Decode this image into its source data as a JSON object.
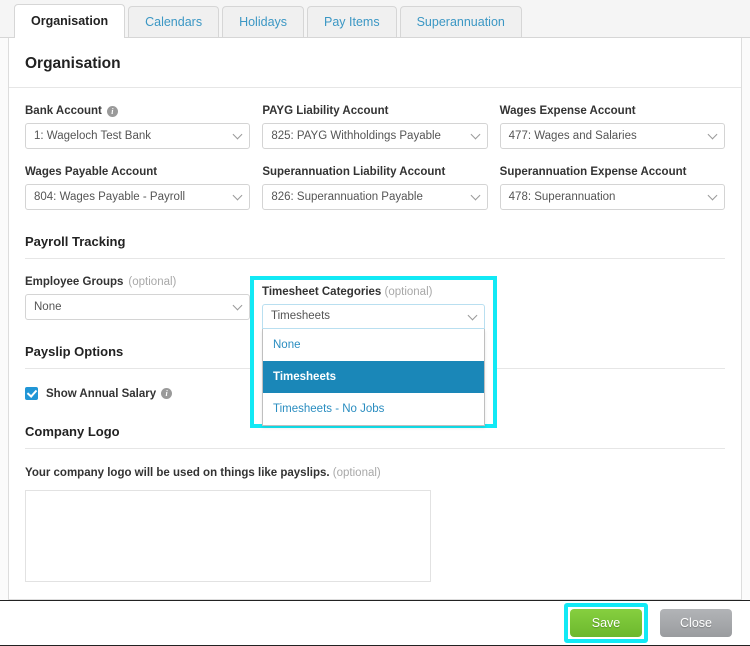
{
  "tabs": [
    {
      "label": "Organisation",
      "active": true
    },
    {
      "label": "Calendars",
      "active": false
    },
    {
      "label": "Holidays",
      "active": false
    },
    {
      "label": "Pay Items",
      "active": false
    },
    {
      "label": "Superannuation",
      "active": false
    }
  ],
  "card": {
    "title": "Organisation"
  },
  "accounts": {
    "row1": [
      {
        "label": "Bank Account",
        "info": true,
        "value": "1: Wageloch Test Bank"
      },
      {
        "label": "PAYG Liability Account",
        "info": false,
        "value": "825: PAYG Withholdings Payable"
      },
      {
        "label": "Wages Expense Account",
        "info": false,
        "value": "477: Wages and Salaries"
      }
    ],
    "row2": [
      {
        "label": "Wages Payable Account",
        "info": false,
        "value": "804: Wages Payable - Payroll"
      },
      {
        "label": "Superannuation Liability Account",
        "info": false,
        "value": "826: Superannuation Payable"
      },
      {
        "label": "Superannuation Expense Account",
        "info": false,
        "value": "478: Superannuation"
      }
    ]
  },
  "payroll_tracking": {
    "heading": "Payroll Tracking",
    "employee_groups": {
      "label": "Employee Groups",
      "optional": "(optional)",
      "value": "None"
    },
    "timesheet_categories": {
      "label": "Timesheet Categories",
      "optional": "(optional)",
      "value": "Timesheets",
      "open": true,
      "options": [
        {
          "label": "None",
          "selected": false
        },
        {
          "label": "Timesheets",
          "selected": true
        },
        {
          "label": "Timesheets - No Jobs",
          "selected": false
        }
      ]
    }
  },
  "payslip_options": {
    "heading": "Payslip Options",
    "show_annual_salary": {
      "label": "Show Annual Salary",
      "checked": true,
      "info": true
    }
  },
  "company_logo": {
    "heading": "Company Logo",
    "description": "Your company logo will be used on things like payslips.",
    "optional": "(optional)"
  },
  "footer": {
    "save_label": "Save",
    "close_label": "Close"
  },
  "colors": {
    "highlight": "#12e9f5",
    "selected_option_bg": "#1a87b8",
    "link_blue": "#2a8dc0",
    "save_green": "#6cb82e",
    "close_gray": "#9a9c9f",
    "checkbox_blue": "#2196d6"
  }
}
